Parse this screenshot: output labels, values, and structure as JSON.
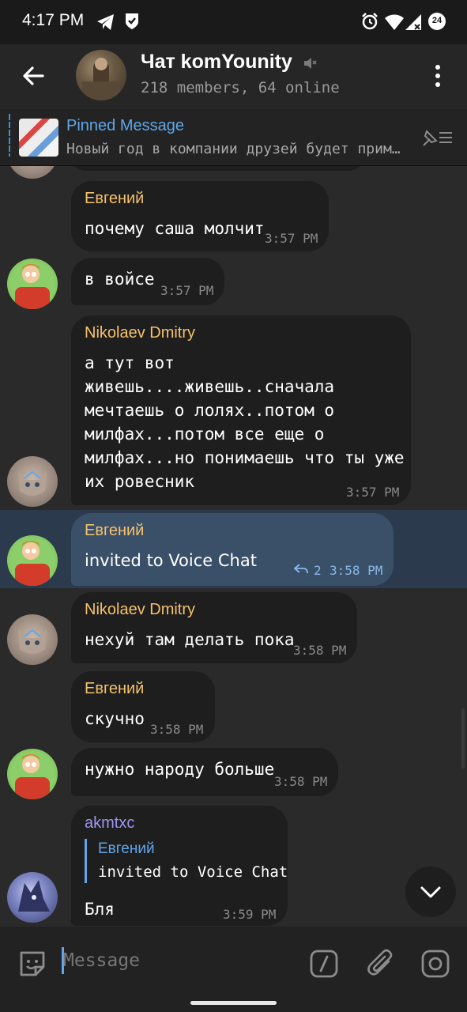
{
  "status_bar": {
    "time": "4:17 PM",
    "battery_label": "24",
    "icons": [
      "telegram-icon",
      "shield-check-icon",
      "alarm-icon",
      "wifi-icon",
      "signal-icon",
      "battery-icon"
    ]
  },
  "header": {
    "title": "Чат komYounity",
    "subtitle": "218 members, 64 online",
    "icons": [
      "back-arrow-icon",
      "mute-icon",
      "more-vertical-icon"
    ]
  },
  "pinned": {
    "title": "Pinned Message",
    "text": "Новый год в компании друзей будет прим…"
  },
  "messages": [
    {
      "sender": "Евгений",
      "text": "почему саша молчит",
      "time": "3:57 PM"
    },
    {
      "text": "в войсе",
      "time": "3:57 PM"
    },
    {
      "sender": "Nikolaev Dmitry",
      "text": "а тут вот\nживешь....живешь..сначала\nмечтаешь о лолях..потом о\nмилфах...потом все еще о\nмилфах...но понимаешь что ты уже\nих ровесник",
      "time": "3:57 PM"
    },
    {
      "sender": "Евгений",
      "text": "invited to Voice Chat",
      "reply_count": "2",
      "time": "3:58 PM"
    },
    {
      "sender": "Nikolaev Dmitry",
      "text": "нехуй там делать пока",
      "time": "3:58 PM"
    },
    {
      "sender": "Евгений",
      "text": "скучно",
      "time": "3:58 PM"
    },
    {
      "text": "нужно народу больше",
      "time": "3:58 PM"
    },
    {
      "sender": "akmtxc",
      "reply_to_sender": "Евгений",
      "reply_to_text": "invited to Voice Chat",
      "text": "Бля",
      "time": "3:59 PM"
    }
  ],
  "input": {
    "placeholder": "Message",
    "icons": [
      "sticker-icon",
      "bot-command-icon",
      "attach-icon",
      "camera-icon"
    ]
  },
  "colors": {
    "accent": "#5ea7ec",
    "sender_evgeniy": "#f5c16c",
    "sender_akmtxc": "#9f97f0",
    "highlight": "#2b3b4d"
  }
}
